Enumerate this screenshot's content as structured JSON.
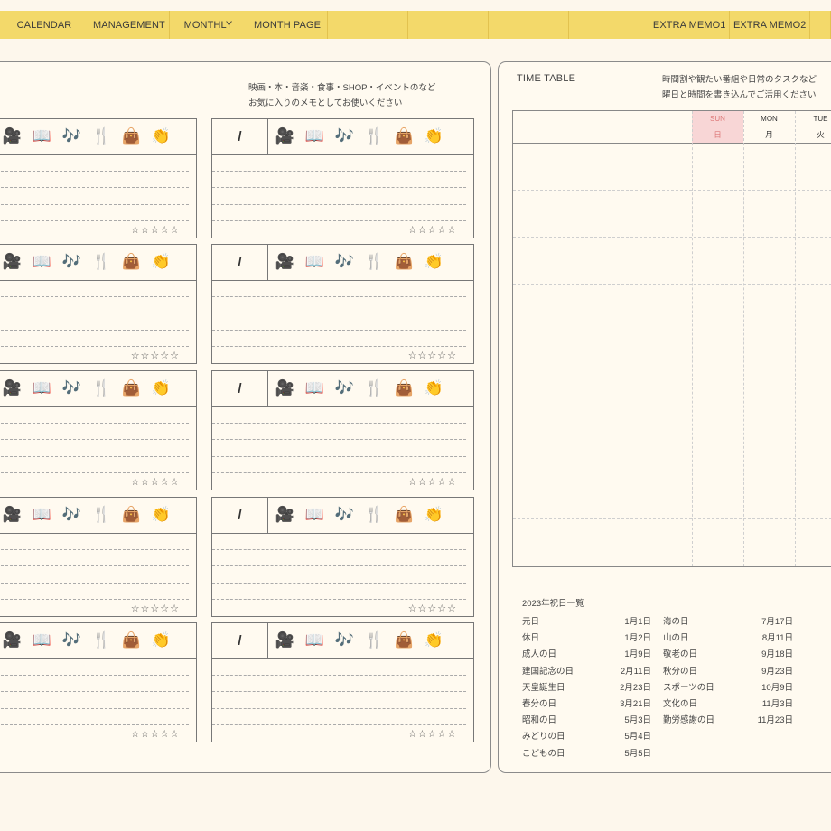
{
  "nav": {
    "tabs": [
      {
        "label": "CALENDAR",
        "w": 100
      },
      {
        "label": "MANAGEMENT",
        "w": 90
      },
      {
        "label": "MONTHLY",
        "w": 87
      },
      {
        "label": "MONTH PAGE",
        "w": 90
      },
      {
        "label": "",
        "w": 90
      },
      {
        "label": "",
        "w": 90
      },
      {
        "label": "",
        "w": 90
      },
      {
        "label": "",
        "w": 90
      },
      {
        "label": "EXTRA MEMO1",
        "w": 90
      },
      {
        "label": "EXTRA MEMO2",
        "w": 90
      },
      {
        "label": "",
        "w": 23
      }
    ]
  },
  "memo": {
    "intro_line1": "映画・本・音楽・食事・SHOP・イベントのなど",
    "intro_line2": "お気に入りのメモとしてお使いください",
    "slash": "/",
    "categories": [
      {
        "icon": "🎥",
        "name": "movie-camera-icon"
      },
      {
        "icon": "📖",
        "name": "book-icon"
      },
      {
        "icon": "🎶",
        "name": "music-notes-icon"
      },
      {
        "icon": "🍴",
        "name": "fork-knife-icon"
      },
      {
        "icon": "👜",
        "name": "handbag-icon"
      },
      {
        "icon": "👏",
        "name": "clapping-hands-icon"
      }
    ],
    "stars": "☆☆☆☆☆"
  },
  "timetable": {
    "title": "TIME TABLE",
    "note_line1": "時間割や観たい番組や日常のタスクなど",
    "note_line2": "曜日と時間を書き込んでご活用ください",
    "days": [
      {
        "en": "SUN",
        "jp": "日",
        "highlight": "#f8d6d6",
        "color": "#d77"
      },
      {
        "en": "MON",
        "jp": "月",
        "highlight": "",
        "color": "#333"
      },
      {
        "en": "TUE",
        "jp": "火",
        "highlight": "",
        "color": "#333"
      }
    ]
  },
  "holidays": {
    "title": "2023年祝日一覧",
    "col1": [
      {
        "name": "元日",
        "date": "1月1日"
      },
      {
        "name": "休日",
        "date": "1月2日"
      },
      {
        "name": "成人の日",
        "date": "1月9日"
      },
      {
        "name": "建国記念の日",
        "date": "2月11日"
      },
      {
        "name": "天皇誕生日",
        "date": "2月23日"
      },
      {
        "name": "春分の日",
        "date": "3月21日"
      },
      {
        "name": "昭和の日",
        "date": "5月3日"
      },
      {
        "name": "みどりの日",
        "date": "5月4日"
      },
      {
        "name": "こどもの日",
        "date": "5月5日"
      }
    ],
    "col2": [
      {
        "name": "海の日",
        "date": "7月17日"
      },
      {
        "name": "山の日",
        "date": "8月11日"
      },
      {
        "name": "敬老の日",
        "date": "9月18日"
      },
      {
        "name": "秋分の日",
        "date": "9月23日"
      },
      {
        "name": "スポーツの日",
        "date": "10月9日"
      },
      {
        "name": "文化の日",
        "date": "11月3日"
      },
      {
        "name": "勤労感謝の日",
        "date": "11月23日"
      }
    ]
  }
}
